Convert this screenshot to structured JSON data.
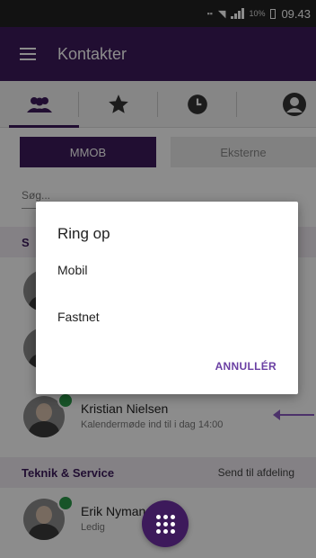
{
  "status_bar": {
    "battery": "10%",
    "time": "09.43"
  },
  "app_bar": {
    "title": "Kontakter",
    "menu_icon": "hamburger-icon"
  },
  "tabs": [
    {
      "icon": "people-icon",
      "active": true
    },
    {
      "icon": "star-icon",
      "active": false
    },
    {
      "icon": "clock-icon",
      "active": false
    },
    {
      "icon": "person-icon",
      "active": false
    }
  ],
  "segments": {
    "first": "MMOB",
    "second": "Eksterne"
  },
  "search": {
    "placeholder": "Søg..."
  },
  "sections": {
    "first_initial": "S",
    "teknik": {
      "name": "Teknik & Service",
      "action": "Send til afdeling"
    }
  },
  "contacts": [
    {
      "name": "Kristian Nielsen",
      "status": "Kalendermøde ind til i dag 14:00"
    },
    {
      "name": "Erik Nyman",
      "status": "Ledig"
    }
  ],
  "dialog": {
    "title": "Ring op",
    "options": [
      "Mobil",
      "Fastnet"
    ],
    "cancel": "ANNULLÉR"
  },
  "colors": {
    "primary": "#3d1a5b",
    "accent": "#6a3fa3",
    "status_green": "#2a9a4a",
    "arrow": "#8a5cc2"
  }
}
